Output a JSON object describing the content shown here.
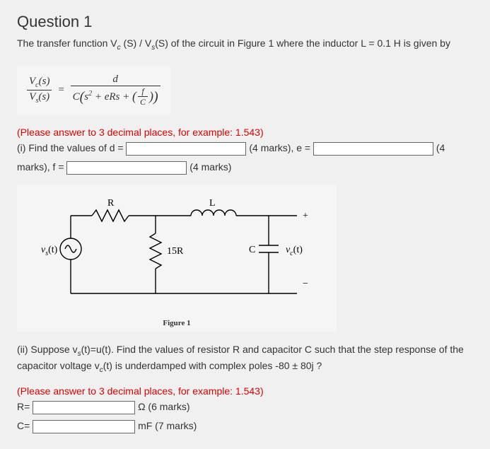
{
  "title": "Question 1",
  "prompt_pre": "The transfer function V",
  "prompt_sub1": "c",
  "prompt_mid1": " (S) / V",
  "prompt_sub2": "s",
  "prompt_mid2": "(S) of the circuit in Figure 1 where the inductor L = 0.1 H is given by",
  "formula": {
    "lhs_num_a": "V",
    "lhs_num_sub": "c",
    "lhs_num_b": "(s)",
    "lhs_den_a": "V",
    "lhs_den_sub": "s",
    "lhs_den_b": "(s)",
    "eq": "=",
    "rhs_num": "d",
    "rhs_den_pre": "C",
    "rhs_den_lp": "(",
    "rhs_den_s": "s",
    "rhs_den_sup": "2",
    "rhs_den_mid": " + eRs + ",
    "rhs_den_inner_lp": "(",
    "rhs_den_frac_num": "f",
    "rhs_den_frac_den": "C",
    "rhs_den_inner_rp": ")",
    "rhs_den_rp": ")"
  },
  "instr1": "(Please answer to 3 decimal places, for example: 1.543)",
  "part_i_pre": "(i) Find the values of d = ",
  "part_i_mid1": " (4 marks), e = ",
  "part_i_mid2": "(4 marks), f = ",
  "part_i_end": "(4 marks)",
  "circuit": {
    "R": "R",
    "L": "L",
    "R2": "15R",
    "C": "C",
    "vs": "v",
    "vs_sub": "s",
    "vs_t": "(t)",
    "vc": "v",
    "vc_sub": "c",
    "vc_t": "(t)",
    "plus": "+",
    "minus": "−",
    "caption": "Figure 1"
  },
  "part_ii_a": "(ii) Suppose v",
  "part_ii_sub_s": "s",
  "part_ii_b": "(t)=u(t). Find the values of resistor R and capacitor C such that the step response of the capacitor voltage v",
  "part_ii_sub_c": "c",
  "part_ii_c": "(t) is underdamped with complex poles -80 ± 80j ?",
  "instr2": "(Please answer to 3 decimal places, for example: 1.543)",
  "R_label": "R=",
  "R_unit": " Ω (6 marks)",
  "C_label": "C=",
  "C_unit": " mF (7 marks)"
}
